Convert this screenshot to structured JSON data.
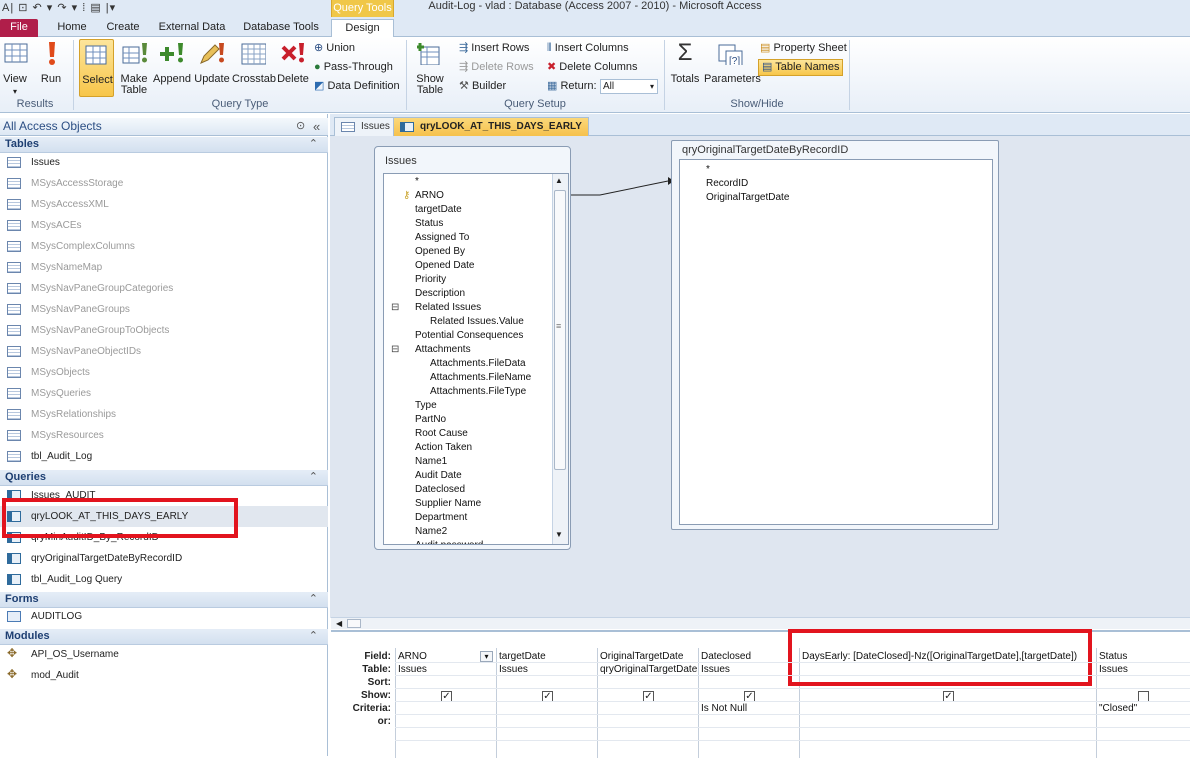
{
  "window": {
    "title": "Audit-Log - vlad : Database (Access 2007 - 2010)  -  Microsoft Access",
    "context_tab": "Query Tools",
    "quick_access": "A|  ⊡ ↶ ▾ ↷ ▾ ⁞ ▤ |▾"
  },
  "tabs": [
    "File",
    "Home",
    "Create",
    "External Data",
    "Database Tools",
    "Design"
  ],
  "ribbon": {
    "results": {
      "view": "View",
      "run": "Run",
      "label": "Results"
    },
    "query_type": {
      "select": "Select",
      "make_table": "Make Table",
      "append": "Append",
      "update": "Update",
      "crosstab": "Crosstab",
      "delete": "Delete",
      "union": "Union",
      "pass_through": "Pass-Through",
      "data_definition": "Data Definition",
      "label": "Query Type"
    },
    "query_setup": {
      "show_table": "Show Table",
      "insert_rows": "Insert Rows",
      "delete_rows": "Delete Rows",
      "builder": "Builder",
      "insert_columns": "Insert Columns",
      "delete_columns": "Delete Columns",
      "return_label": "Return:",
      "return_value": "All",
      "label": "Query Setup"
    },
    "show_hide": {
      "totals": "Totals",
      "parameters": "Parameters",
      "property_sheet": "Property Sheet",
      "table_names": "Table Names",
      "label": "Show/Hide"
    }
  },
  "nav": {
    "header": "All Access Objects",
    "sections": {
      "tables": "Tables",
      "queries": "Queries",
      "forms": "Forms",
      "modules": "Modules"
    },
    "tables": [
      "Issues",
      "MSysAccessStorage",
      "MSysAccessXML",
      "MSysACEs",
      "MSysComplexColumns",
      "MSysNameMap",
      "MSysNavPaneGroupCategories",
      "MSysNavPaneGroups",
      "MSysNavPaneGroupToObjects",
      "MSysNavPaneObjectIDs",
      "MSysObjects",
      "MSysQueries",
      "MSysRelationships",
      "MSysResources",
      "tbl_Audit_Log"
    ],
    "queries": [
      "Issues_AUDIT",
      "qryLOOK_AT_THIS_DAYS_EARLY",
      "qryMinAuditID_By_RecordID",
      "qryOriginalTargetDateByRecordID",
      "tbl_Audit_Log Query"
    ],
    "forms": [
      "AUDITLOG"
    ],
    "modules": [
      "API_OS_Username",
      "mod_Audit"
    ]
  },
  "doc_tabs": [
    "Issues",
    "qryLOOK_AT_THIS_DAYS_EARLY"
  ],
  "design": {
    "issues_table": {
      "title": "Issues",
      "fields": [
        "*",
        "ARNO",
        "targetDate",
        "Status",
        "Assigned To",
        "Opened By",
        "Opened Date",
        "Priority",
        "Description",
        "Related Issues",
        "Related Issues.Value",
        "Potential Consequences",
        "Attachments",
        "Attachments.FileData",
        "Attachments.FileName",
        "Attachments.FileType",
        "Type",
        "PartNo",
        "Root Cause",
        "Action Taken",
        "Name1",
        "Audit Date",
        "Dateclosed",
        "Supplier Name",
        "Department",
        "Name2",
        "Audit password"
      ]
    },
    "orig_table": {
      "title": "qryOriginalTargetDateByRecordID",
      "fields": [
        "*",
        "RecordID",
        "OriginalTargetDate"
      ]
    }
  },
  "grid": {
    "row_labels": [
      "Field:",
      "Table:",
      "Sort:",
      "Show:",
      "Criteria:",
      "or:"
    ],
    "columns": [
      {
        "field": "ARNO",
        "table": "Issues",
        "show": true,
        "criteria": ""
      },
      {
        "field": "targetDate",
        "table": "Issues",
        "show": true,
        "criteria": ""
      },
      {
        "field": "OriginalTargetDate",
        "table": "qryOriginalTargetDate",
        "show": true,
        "criteria": ""
      },
      {
        "field": "Dateclosed",
        "table": "Issues",
        "show": true,
        "criteria": "Is Not Null"
      },
      {
        "field": "DaysEarly: [DateClosed]-Nz([OriginalTargetDate],[targetDate])",
        "table": "",
        "show": true,
        "criteria": ""
      },
      {
        "field": "Status",
        "table": "Issues",
        "show": false,
        "criteria": "\"Closed\""
      }
    ]
  }
}
